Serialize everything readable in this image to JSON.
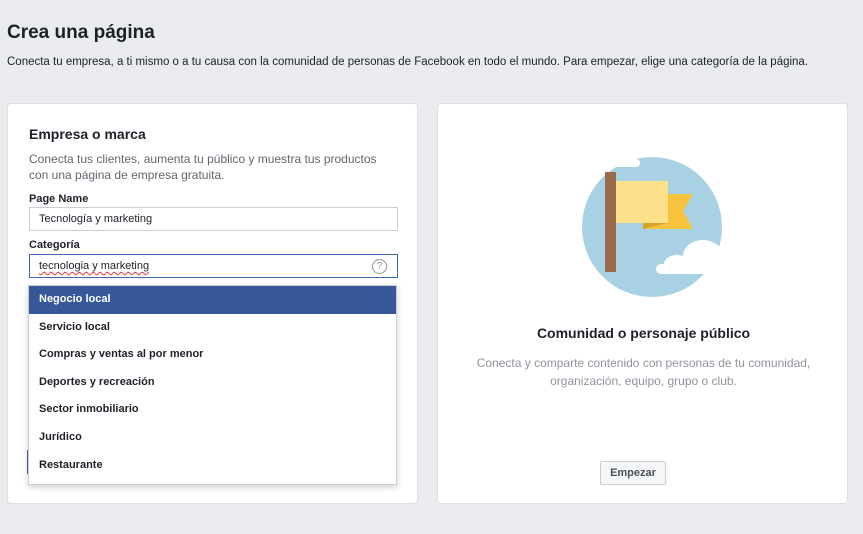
{
  "header": {
    "title": "Crea una página",
    "subtitle": "Conecta tu empresa, a ti mismo o a tu causa con la comunidad de personas de Facebook en todo el mundo. Para empezar, elige una categoría de la página."
  },
  "business_card": {
    "title": "Empresa o marca",
    "description": "Conecta tus clientes, aumenta tu público y muestra tus productos con una página de empresa gratuita.",
    "page_name_label": "Page Name",
    "page_name_value": "Tecnología y marketing",
    "category_label": "Categoría",
    "category_value": "tecnologia y marketing",
    "help_glyph": "?",
    "help_icon": "question-circle-icon",
    "dropdown": {
      "items": [
        "Negocio local",
        "Servicio local",
        "Compras y ventas al por menor",
        "Deportes y recreación",
        "Sector inmobiliario",
        "Jurídico",
        "Restaurante"
      ],
      "selected_index": 0
    }
  },
  "community_card": {
    "title": "Comunidad o personaje público",
    "description": "Conecta y comparte contenido con personas de tu comunidad, organización, equipo, grupo o club.",
    "start_label": "Empezar",
    "illustration_icon": "flag-illustration"
  },
  "colors": {
    "background": "#e9ebee",
    "card": "#ffffff",
    "accent": "#365899",
    "input_focus": "#4267b2",
    "circle": "#a8d2e4",
    "flag_yellow": "#f7c33c",
    "flag_light": "#fde08a",
    "pole": "#9a6b4a"
  }
}
